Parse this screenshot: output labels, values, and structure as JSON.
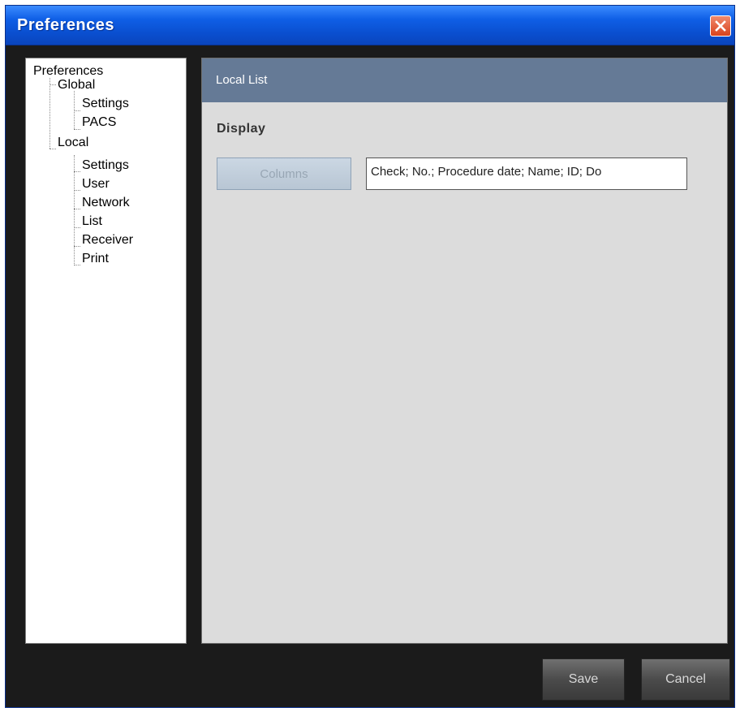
{
  "window": {
    "title": "Preferences",
    "close_icon": "close-icon"
  },
  "tree": {
    "root": "Preferences",
    "global": {
      "label": "Global",
      "children": [
        "Settings",
        "PACS"
      ]
    },
    "local": {
      "label": "Local",
      "children": [
        "Settings",
        "User",
        "Network",
        "List",
        "Receiver",
        "Print"
      ]
    }
  },
  "content": {
    "header": "Local List",
    "section": "Display",
    "columns_button": "Columns",
    "columns_value": "Check; No.; Procedure date; Name; ID; Do"
  },
  "footer": {
    "save": "Save",
    "cancel": "Cancel"
  },
  "colors": {
    "titlebar": "#0a4fd0",
    "content_header": "#657a96",
    "content_bg": "#dcdcdc",
    "window_bg": "#1b1b1b"
  }
}
